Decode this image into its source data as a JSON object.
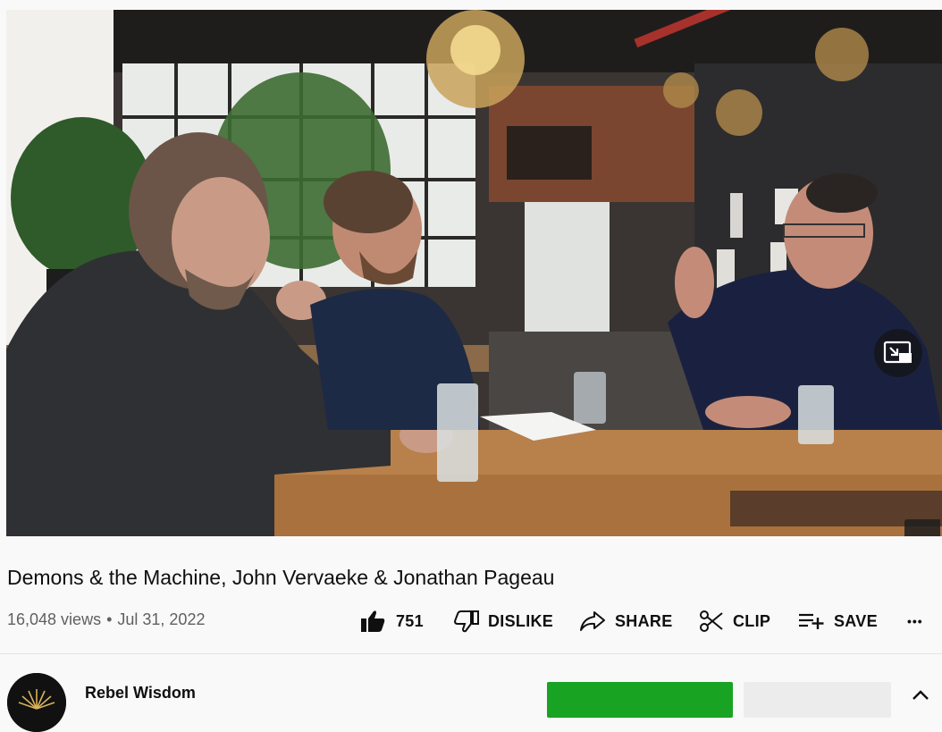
{
  "video": {
    "title": "Demons & the Machine, John Vervaeke & Jonathan Pageau",
    "views": "16,048 views",
    "separator": "•",
    "date": "Jul 31, 2022"
  },
  "actions": {
    "like_count": "751",
    "dislike_label": "DISLIKE",
    "share_label": "SHARE",
    "clip_label": "CLIP",
    "save_label": "SAVE",
    "more_label": "•••"
  },
  "channel": {
    "name": "Rebel Wisdom"
  },
  "colors": {
    "join_button": "#18a323",
    "subscribe_button": "#ececec",
    "text_primary": "#0f0f0f",
    "text_secondary": "#606060"
  },
  "icons": {
    "like": "thumb-up-icon",
    "dislike": "thumb-down-icon",
    "share": "share-arrow-icon",
    "clip": "scissors-icon",
    "save": "playlist-add-icon",
    "more": "more-dots-icon",
    "pip": "miniplayer-icon"
  }
}
